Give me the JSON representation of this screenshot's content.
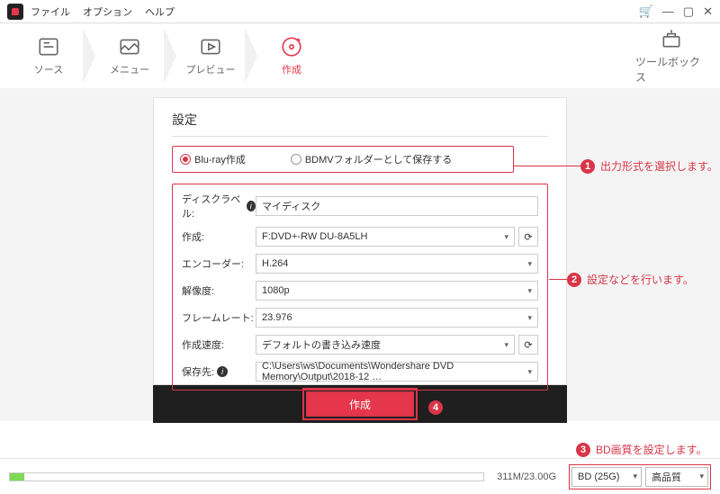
{
  "menu": {
    "file": "ファイル",
    "option": "オプション",
    "help": "ヘルプ"
  },
  "nav": {
    "source": "ソース",
    "menu": "メニュー",
    "preview": "プレビュー",
    "create": "作成",
    "toolbox": "ツールボックス"
  },
  "settings": {
    "title": "設定",
    "format1": "Blu-ray作成",
    "format2": "BDMVフォルダーとして保存する",
    "disc_label_lbl": "ディスクラベル:",
    "disc_label_val": "マイディスク",
    "create_lbl": "作成:",
    "create_val": "F:DVD+-RW DU-8A5LH",
    "encoder_lbl": "エンコーダー:",
    "encoder_val": "H.264",
    "resolution_lbl": "解像度:",
    "resolution_val": "1080p",
    "framerate_lbl": "フレームレート:",
    "framerate_val": "23.976",
    "speed_lbl": "作成速度:",
    "speed_val": "デフォルトの書き込み速度",
    "saveto_lbl": "保存先:",
    "saveto_val": "C:\\Users\\ws\\Documents\\Wondershare DVD Memory\\Output\\2018-12 …"
  },
  "create_btn": "作成",
  "footer": {
    "size": "311M/23.00G",
    "disc": "BD (25G)",
    "quality": "高品質"
  },
  "annotations": {
    "a1": "出力形式を選択します。",
    "a2": "設定などを行います。",
    "a3": "BD画質を設定します。",
    "n1": "1",
    "n2": "2",
    "n3": "3",
    "n4": "4"
  }
}
